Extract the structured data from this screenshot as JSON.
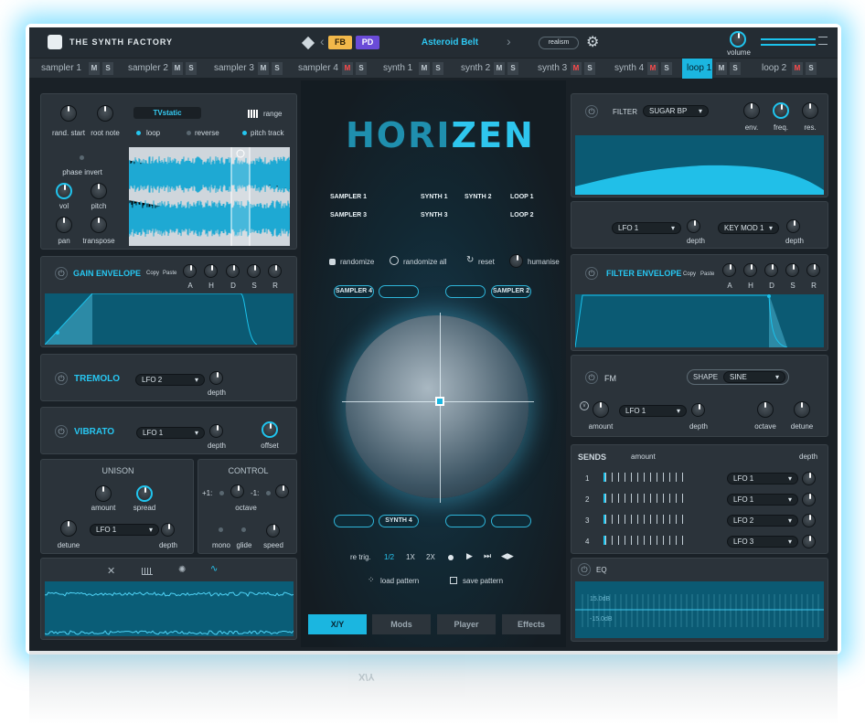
{
  "header": {
    "brand": "THE SYNTH FACTORY",
    "badge_fb": "FB",
    "badge_pd": "PD",
    "preset": "Asteroid Belt",
    "realism": "realism",
    "volume_label": "volume"
  },
  "tabs": [
    {
      "label": "sampler 1",
      "m": "M",
      "s": "S",
      "mute": false
    },
    {
      "label": "sampler 2",
      "m": "M",
      "s": "S",
      "mute": false
    },
    {
      "label": "sampler 3",
      "m": "M",
      "s": "S",
      "mute": false
    },
    {
      "label": "sampler 4",
      "m": "M",
      "s": "S",
      "mute": true
    },
    {
      "label": "synth 1",
      "m": "M",
      "s": "S",
      "mute": false
    },
    {
      "label": "synth 2",
      "m": "M",
      "s": "S",
      "mute": false
    },
    {
      "label": "synth 3",
      "m": "M",
      "s": "S",
      "mute": true
    },
    {
      "label": "synth 4",
      "m": "M",
      "s": "S",
      "mute": true
    },
    {
      "label": "loop 1",
      "m": "M",
      "s": "S",
      "mute": false,
      "active": true
    },
    {
      "label": "loop 2",
      "m": "M",
      "s": "S",
      "mute": true
    }
  ],
  "sampler": {
    "rand_start": "rand. start",
    "root_note": "root note",
    "preset": "TVstatic",
    "range": "range",
    "loop": "loop",
    "reverse": "reverse",
    "pitch_track": "pitch track",
    "phase_invert": "phase invert",
    "vol": "vol",
    "pitch": "pitch",
    "pan": "pan",
    "transpose": "transpose"
  },
  "gain_env": {
    "title": "GAIN ENVELOPE",
    "copy": "Copy",
    "paste": "Paste",
    "a": "A",
    "h": "H",
    "d": "D",
    "s": "S",
    "r": "R"
  },
  "tremolo": {
    "title": "TREMOLO",
    "lfo": "LFO 2",
    "depth": "depth"
  },
  "vibrato": {
    "title": "VIBRATO",
    "lfo": "LFO 1",
    "depth": "depth",
    "offset": "offset"
  },
  "unison": {
    "title": "UNISON",
    "amount": "amount",
    "spread": "spread",
    "detune": "detune",
    "lfo": "LFO 1",
    "depth": "depth"
  },
  "control": {
    "title": "CONTROL",
    "plus1": "+1:",
    "minus1": "-1:",
    "octave": "octave",
    "mono": "mono",
    "glide": "glide",
    "speed": "speed"
  },
  "center": {
    "logo_a": "HORI",
    "logo_b": "ZEN",
    "slots": [
      "SAMPLER 1",
      "SYNTH 1",
      "SYNTH 2",
      "LOOP 1",
      "SAMPLER 3",
      "SYNTH 3",
      "LOOP 2"
    ],
    "randomize": "randomize",
    "randomize_all": "randomize all",
    "reset": "reset",
    "humanise": "humanise",
    "corner_tl": "SAMPLER 4",
    "corner_tr": "SAMPLER 2",
    "corner_bl": "SYNTH 4",
    "retrig": "re trig.",
    "r_half": "1/2",
    "r_1x": "1X",
    "r_2x": "2X",
    "load": "load pattern",
    "save": "save pattern",
    "tabs": [
      "X/Y",
      "Mods",
      "Player",
      "Effects"
    ]
  },
  "filter": {
    "label": "FILTER",
    "type": "SUGAR BP",
    "env": "env.",
    "freq": "freq.",
    "res": "res."
  },
  "mods": {
    "lfo": "LFO 1",
    "depth1": "depth",
    "keymod": "KEY MOD 1",
    "depth2": "depth"
  },
  "filter_env": {
    "title": "FILTER ENVELOPE",
    "copy": "Copy",
    "paste": "Paste",
    "a": "A",
    "h": "H",
    "d": "D",
    "s": "S",
    "r": "R"
  },
  "fm": {
    "title": "FM",
    "shape_label": "SHAPE",
    "shape": "SINE",
    "amount": "amount",
    "lfo": "LFO 1",
    "depth": "depth",
    "octave": "octave",
    "detune": "detune"
  },
  "sends": {
    "title": "SENDS",
    "amount": "amount",
    "depth": "depth",
    "rows": [
      {
        "n": "1",
        "lfo": "LFO 1"
      },
      {
        "n": "2",
        "lfo": "LFO 1"
      },
      {
        "n": "3",
        "lfo": "LFO 2"
      },
      {
        "n": "4",
        "lfo": "LFO 3"
      }
    ]
  },
  "eq": {
    "title": "EQ",
    "top": "15.0dB",
    "bot": "-15.0dB"
  }
}
